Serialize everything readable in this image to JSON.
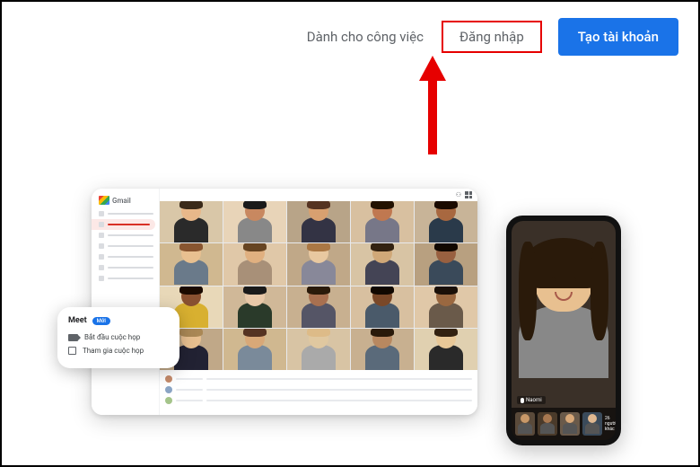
{
  "nav": {
    "for_work": "Dành cho công việc",
    "sign_in": "Đăng nhập",
    "create_account": "Tạo tài khoản"
  },
  "meet_popup": {
    "title": "Meet",
    "badge": "Mới",
    "start": "Bắt đầu cuộc họp",
    "join": "Tham gia cuộc họp"
  },
  "gmail": {
    "label": "Gmail",
    "items": [
      "",
      "",
      "",
      "",
      "",
      "",
      ""
    ]
  },
  "phone": {
    "name_label": "Naomi",
    "more_count": "26 người khác"
  },
  "tiles": [
    {
      "bg": "#d9c7a8",
      "skin": "#e8b88a",
      "hair": "#3a2a1a",
      "shirt": "#2a2a2a"
    },
    {
      "bg": "#e8d4b8",
      "skin": "#c88860",
      "hair": "#1a1a1a",
      "shirt": "#888"
    },
    {
      "bg": "#b8a488",
      "skin": "#d8a070",
      "hair": "#553322",
      "shirt": "#334"
    },
    {
      "bg": "#d8c0a0",
      "skin": "#c07850",
      "hair": "#221100",
      "shirt": "#778"
    },
    {
      "bg": "#c8b498",
      "skin": "#a86840",
      "hair": "#1a0a00",
      "shirt": "#2a3a4a"
    },
    {
      "bg": "#d0b890",
      "skin": "#e8c090",
      "hair": "#885530",
      "shirt": "#6a7a8a"
    },
    {
      "bg": "#e0c8a8",
      "skin": "#e0b080",
      "hair": "#664422",
      "shirt": "#a89078"
    },
    {
      "bg": "#c0a888",
      "skin": "#e8c8a0",
      "hair": "#aa7744",
      "shirt": "#889"
    },
    {
      "bg": "#d8c4a4",
      "skin": "#d0a878",
      "hair": "#332211",
      "shirt": "#445"
    },
    {
      "bg": "#b8a080",
      "skin": "#986040",
      "hair": "#110800",
      "shirt": "#3a4a5a"
    },
    {
      "bg": "#e8d8b8",
      "skin": "#885030",
      "hair": "#1a0a00",
      "shirt": "#d8b030"
    },
    {
      "bg": "#d0b898",
      "skin": "#e8c8a8",
      "hair": "#1a1a1a",
      "shirt": "#2a3a2a"
    },
    {
      "bg": "#c8b090",
      "skin": "#a87050",
      "hair": "#2a1a0a",
      "shirt": "#556"
    },
    {
      "bg": "#d8c0a0",
      "skin": "#7a4828",
      "hair": "#110800",
      "shirt": "#4a5a6a"
    },
    {
      "bg": "#e0c8a8",
      "skin": "#9a6840",
      "hair": "#1a1008",
      "shirt": "#6a5a4a"
    },
    {
      "bg": "#c0a888",
      "skin": "#e8c090",
      "hair": "#aa8855",
      "shirt": "#223"
    },
    {
      "bg": "#d0b890",
      "skin": "#d8a878",
      "hair": "#553322",
      "shirt": "#7a8a9a"
    },
    {
      "bg": "#d8c4a4",
      "skin": "#e0c8a0",
      "hair": "#ddbb88",
      "shirt": "#aaa"
    },
    {
      "bg": "#c8b090",
      "skin": "#b88860",
      "hair": "#2a1a0a",
      "shirt": "#5a6a7a"
    },
    {
      "bg": "#e0d0b0",
      "skin": "#e8c898",
      "hair": "#332211",
      "shirt": "#2a2a2a"
    }
  ],
  "phone_main": {
    "bg": "#3a3028",
    "skin": "#e8c090",
    "hair": "#2a1a0a",
    "shirt": "#888"
  },
  "phone_thumbs": [
    {
      "bg": "#5a4a3a",
      "skin": "#c89868"
    },
    {
      "bg": "#4a3a2a",
      "skin": "#a87850"
    },
    {
      "bg": "#6a5a4a",
      "skin": "#d8a878"
    },
    {
      "bg": "#3a4a5a",
      "skin": "#e0b890"
    }
  ]
}
